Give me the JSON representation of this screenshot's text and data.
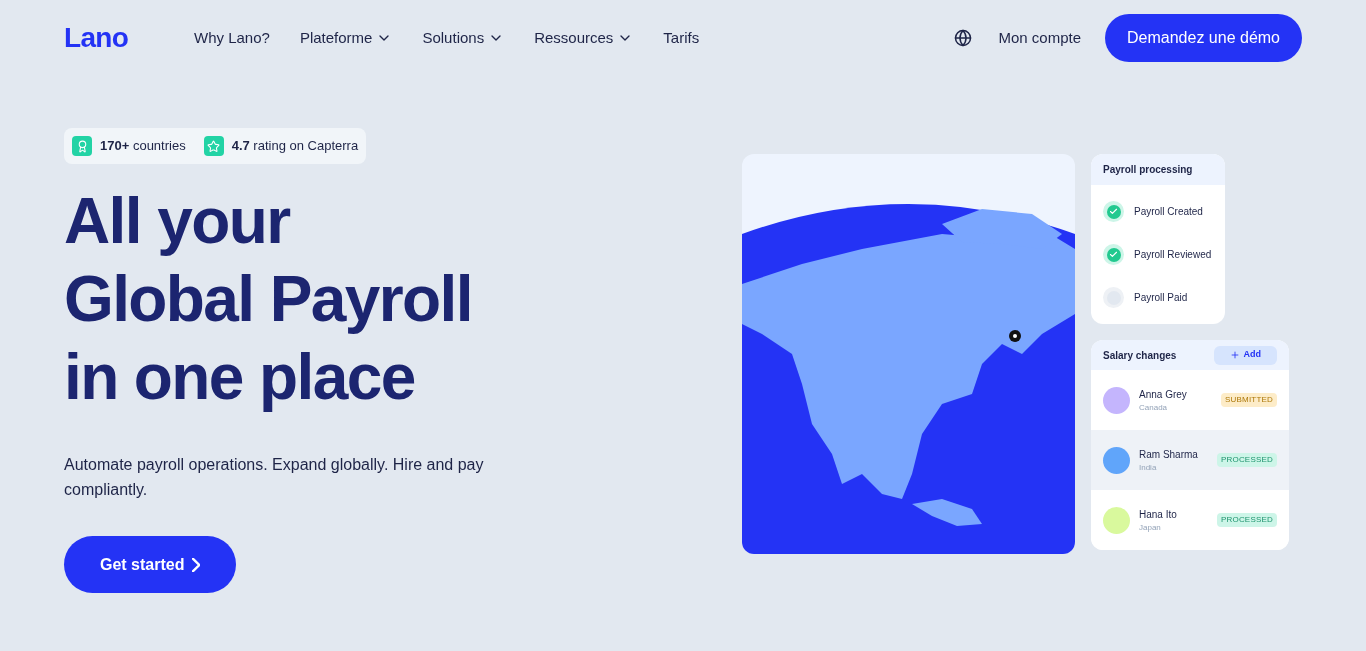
{
  "nav": {
    "logo": "Lano",
    "links": [
      {
        "label": "Why Lano?",
        "has_menu": false
      },
      {
        "label": "Plateforme",
        "has_menu": true
      },
      {
        "label": "Solutions",
        "has_menu": true
      },
      {
        "label": "Ressources",
        "has_menu": true
      },
      {
        "label": "Tarifs",
        "has_menu": false
      }
    ],
    "account": "Mon compte",
    "cta": "Demandez une démo"
  },
  "hero": {
    "stats": [
      {
        "text": "**170+** countries",
        "kind": "award"
      },
      {
        "text": "**4.7** rating on Capterra",
        "kind": "star"
      }
    ],
    "title_lines": [
      "All your",
      "Global Payroll",
      "in one place"
    ],
    "subtitle": "Automate payroll operations. Expand globally. Hire and pay compliantly.",
    "button": "Get started"
  },
  "payroll": {
    "title": "Payroll processing",
    "steps": [
      {
        "label": "Payroll Created",
        "done": true
      },
      {
        "label": "Payroll Reviewed",
        "done": true
      },
      {
        "label": "Payroll Paid",
        "done": false
      }
    ]
  },
  "salary": {
    "title": "Salary changes",
    "add": "Add",
    "rows": [
      {
        "name": "Anna Grey",
        "country": "Canada",
        "status": {
          "text": "SUBMITTED",
          "color": "#fdecc8"
        },
        "highlighted": false,
        "color": "#c4b5fd"
      },
      {
        "name": "Ram Sharma",
        "country": "India",
        "status": {
          "text": "PROCESSED",
          "color": "#cdf5e8"
        },
        "highlighted": true,
        "color": "#60a5fa"
      },
      {
        "name": "Hana Ito",
        "country": "Japan",
        "status": {
          "text": "PROCESSED",
          "color": "#cdf5e8"
        },
        "highlighted": false,
        "color": "#d9f99d"
      }
    ]
  }
}
